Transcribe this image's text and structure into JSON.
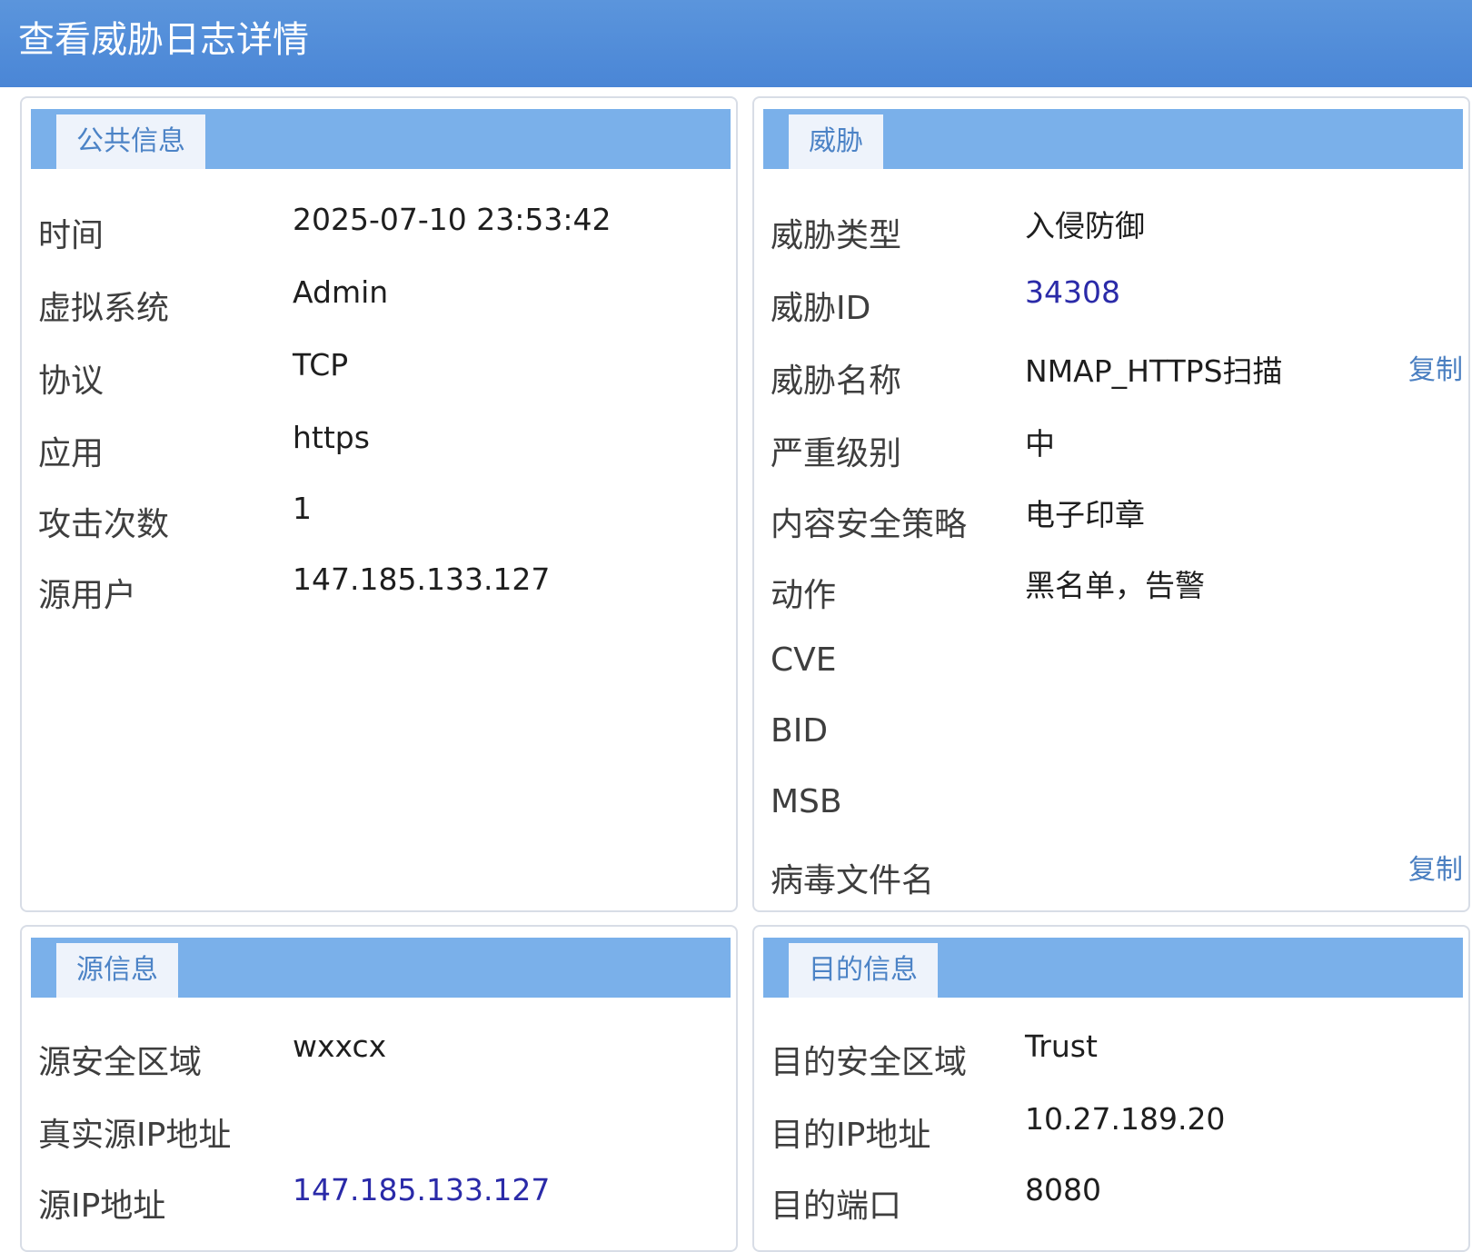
{
  "window": {
    "title": "查看威胁日志详情"
  },
  "public_info": {
    "tab": "公共信息",
    "rows": [
      {
        "label": "时间",
        "value": "2025-07-10 23:53:42"
      },
      {
        "label": "虚拟系统",
        "value": "Admin"
      },
      {
        "label": "协议",
        "value": "TCP"
      },
      {
        "label": "应用",
        "value": "https"
      },
      {
        "label": "攻击次数",
        "value": "1"
      },
      {
        "label": "源用户",
        "value": "147.185.133.127"
      }
    ]
  },
  "threat": {
    "tab": "威胁",
    "copy_label": "复制",
    "rows": [
      {
        "label": "威胁类型",
        "value": "入侵防御"
      },
      {
        "label": "威胁ID",
        "value": "34308"
      },
      {
        "label": "威胁名称",
        "value": "NMAP_HTTPS扫描"
      },
      {
        "label": "严重级别",
        "value": "中"
      },
      {
        "label": "内容安全策略",
        "value": "电子印章"
      },
      {
        "label": "动作",
        "value": "黑名单，告警"
      },
      {
        "label": "CVE",
        "value": ""
      },
      {
        "label": "BID",
        "value": ""
      },
      {
        "label": "MSB",
        "value": ""
      },
      {
        "label": "病毒文件名",
        "value": ""
      }
    ]
  },
  "source_info": {
    "tab": "源信息",
    "rows": [
      {
        "label": "源安全区域",
        "value": "wxxcx"
      },
      {
        "label": "真实源IP地址",
        "value": ""
      },
      {
        "label": "源IP地址",
        "value": "147.185.133.127"
      }
    ]
  },
  "dest_info": {
    "tab": "目的信息",
    "rows": [
      {
        "label": "目的安全区域",
        "value": "Trust"
      },
      {
        "label": "目的IP地址",
        "value": "10.27.189.20"
      },
      {
        "label": "目的端口",
        "value": "8080"
      }
    ]
  },
  "colors": {
    "title_bar": "#4a86d6",
    "panel_header": "#7ab0ea",
    "link": "#2a2aa8"
  }
}
